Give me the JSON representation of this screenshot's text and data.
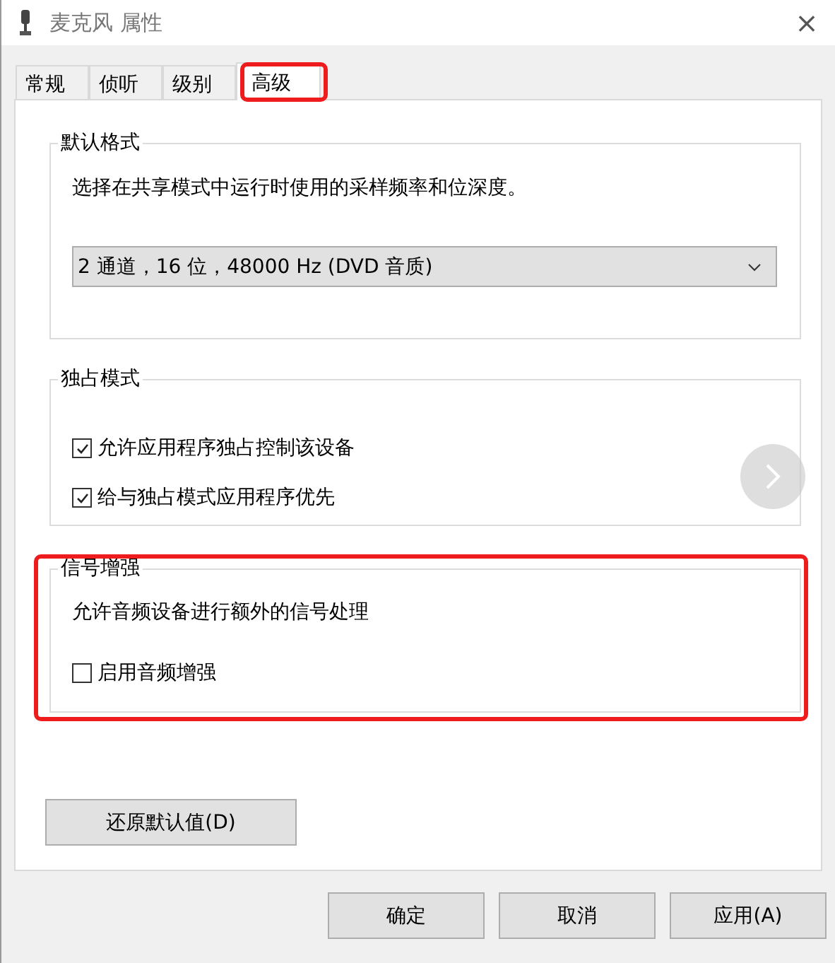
{
  "window": {
    "title": "麦克风 属性",
    "close": "×"
  },
  "tabs": [
    {
      "label": "常规",
      "selected": false
    },
    {
      "label": "侦听",
      "selected": false
    },
    {
      "label": "级别",
      "selected": false
    },
    {
      "label": "高级",
      "selected": true
    }
  ],
  "groups": [
    {
      "title": "默认格式",
      "items": [
        {
          "kind": "text",
          "text": "选择在共享模式中运行时使用的采样频率和位深度。"
        },
        {
          "kind": "select",
          "value": "2 通道，16 位，48000 Hz (DVD 音质)"
        }
      ]
    },
    {
      "title": "独占模式",
      "items": [
        {
          "kind": "checkbox",
          "label": "允许应用程序独占控制该设备",
          "checked": true
        },
        {
          "kind": "checkbox",
          "label": "给与独占模式应用程序优先",
          "checked": true
        }
      ]
    },
    {
      "title": "信号增强",
      "items": [
        {
          "kind": "text",
          "text": "允许音频设备进行额外的信号处理"
        },
        {
          "kind": "checkbox",
          "label": "启用音频增强",
          "checked": false
        }
      ]
    }
  ],
  "restore_button": "还原默认值(D)",
  "buttons": [
    "确定",
    "取消",
    "应用(A)"
  ]
}
